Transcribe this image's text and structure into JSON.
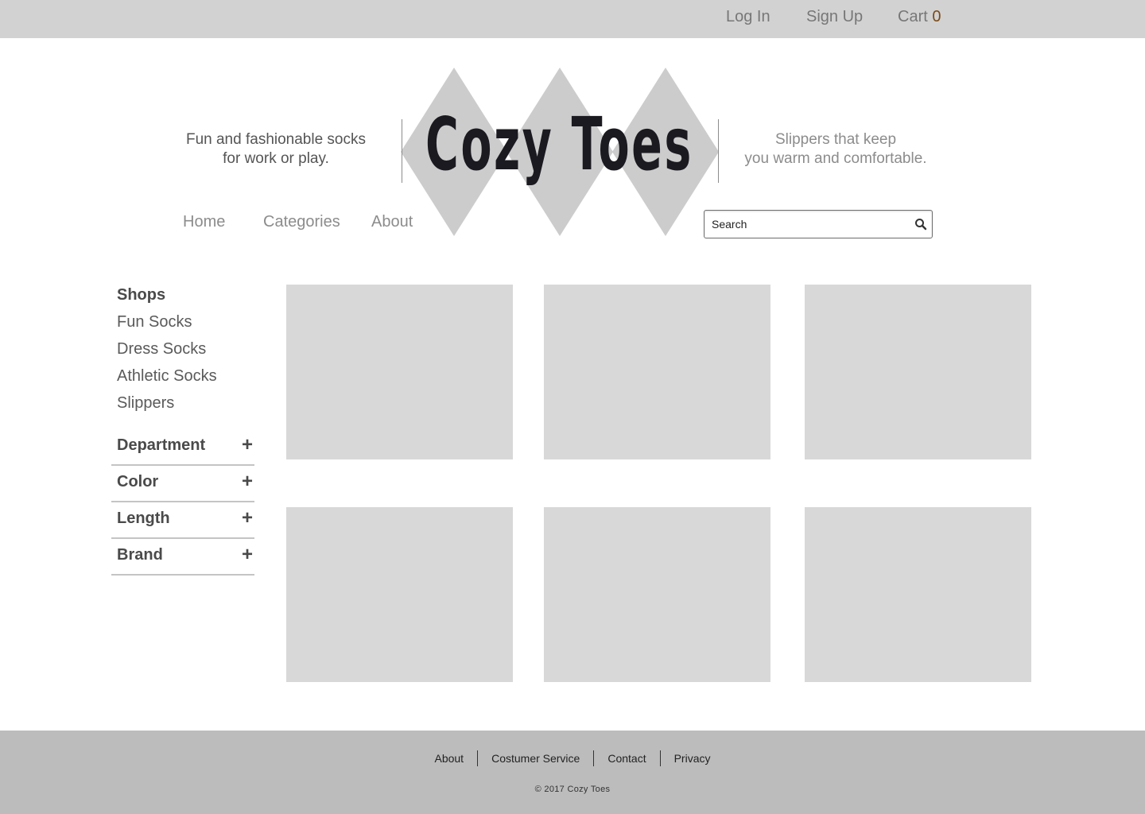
{
  "topbar": {
    "login": "Log In",
    "signup": "Sign Up",
    "cart_label": "Cart",
    "cart_count": "0"
  },
  "header": {
    "logo": "Cozy Toes",
    "tagline_left_line1": "Fun and fashionable socks",
    "tagline_left_line2": "for work or play.",
    "tagline_right_line1": "Slippers that keep",
    "tagline_right_line2": "you warm and comfortable."
  },
  "nav": {
    "home": "Home",
    "categories": "Categories",
    "about": "About"
  },
  "search": {
    "placeholder": "Search",
    "icon": "search-icon"
  },
  "sidebar": {
    "shops_title": "Shops",
    "shops": [
      "Fun Socks",
      "Dress Socks",
      "Athletic Socks",
      "Slippers"
    ],
    "filters": [
      "Department",
      "Color",
      "Length",
      "Brand"
    ],
    "filter_icon": "plus-icon",
    "filter_symbol": "+"
  },
  "footer": {
    "links": [
      "About",
      "Costumer Service",
      "Contact",
      "Privacy"
    ],
    "copyright": "© 2017 Cozy Toes"
  },
  "colors": {
    "topbar_bg": "#d2d2d2",
    "footer_bg": "#bcbcbc",
    "tile_bg": "#d8d8d8",
    "diamond": "#cccccc",
    "logo": "#1b1a20",
    "cart_count": "#7a4a1a"
  }
}
